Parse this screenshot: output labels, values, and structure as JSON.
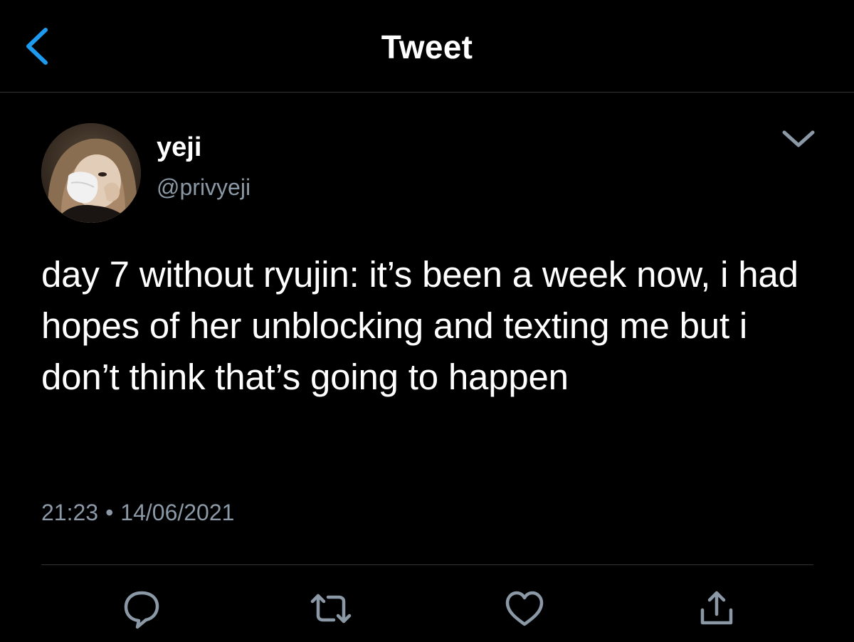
{
  "header": {
    "title": "Tweet",
    "back_icon": "chevron-left-icon"
  },
  "tweet": {
    "author": {
      "display_name": "yeji",
      "handle": "@privyeji"
    },
    "text": "day 7 without ryujin: it’s been a week now, i had hopes of her unblocking and texting me but i don’t think that’s going to happen",
    "time": "21:23",
    "separator": "•",
    "date": "14/06/2021"
  },
  "actions": [
    {
      "icon": "reply-icon"
    },
    {
      "icon": "retweet-icon"
    },
    {
      "icon": "like-icon"
    },
    {
      "icon": "share-icon"
    }
  ],
  "colors": {
    "background": "#000000",
    "text": "#ffffff",
    "secondary_text": "#8b98a5",
    "accent": "#1d9bf0",
    "divider": "#2f3336"
  }
}
